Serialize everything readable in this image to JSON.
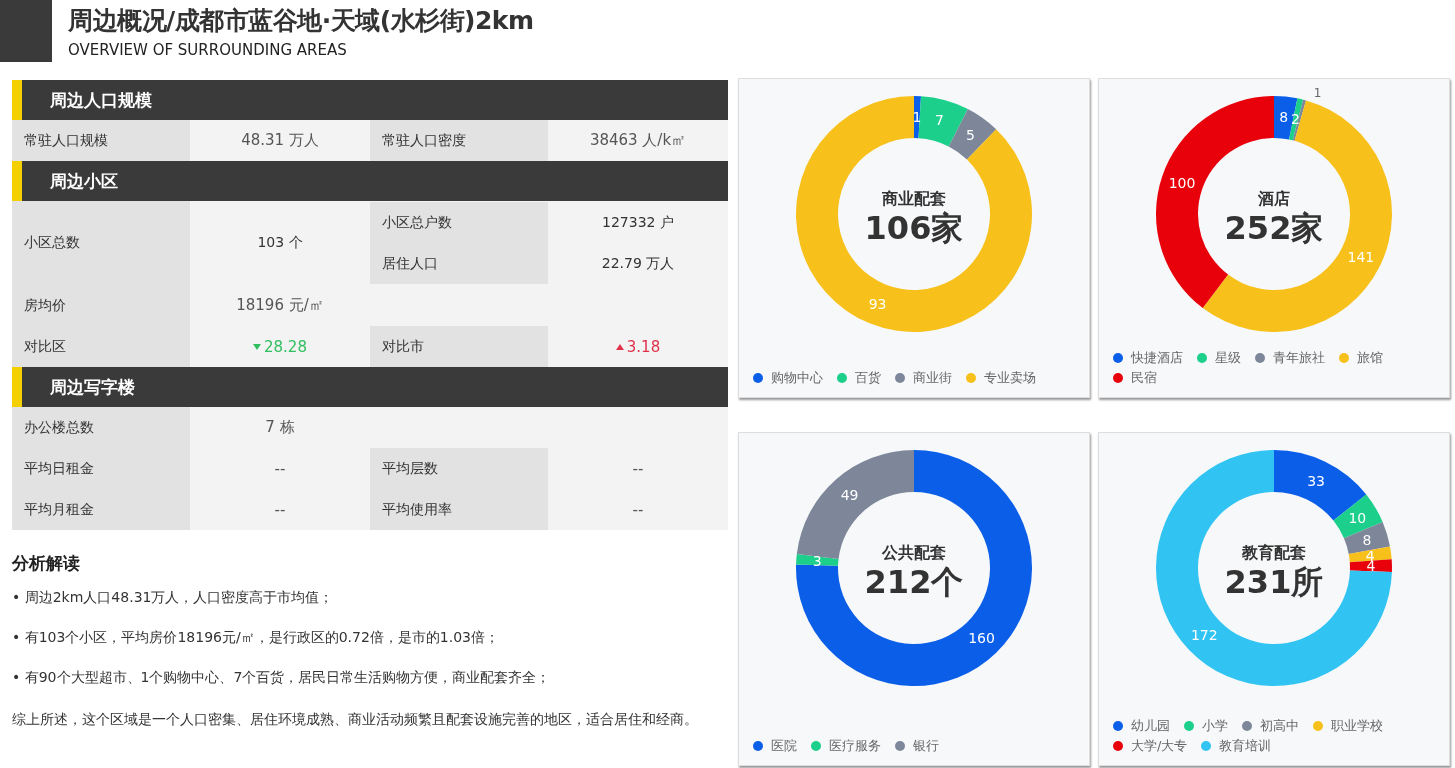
{
  "header": {
    "title": "周边概况/成都市蓝谷地·天域(水杉街)2km",
    "subtitle": "OVERVIEW OF SURROUNDING AREAS"
  },
  "sections": [
    {
      "title": "周边人口规模",
      "rows": [
        {
          "kind": "pair",
          "cells": [
            {
              "label": "常驻人口规模",
              "value": "48.31 万人"
            },
            {
              "label": "常驻人口密度",
              "value": "38463 人/k㎡"
            }
          ]
        }
      ]
    },
    {
      "title": "周边小区",
      "rows": [
        {
          "kind": "stacked",
          "cells": [
            {
              "label": "小区总数",
              "value": "103 个"
            }
          ],
          "side": [
            {
              "label": "小区总户数",
              "value": "127332 户"
            },
            {
              "label": "居住人口",
              "value": "22.79 万人"
            }
          ]
        },
        {
          "kind": "pair",
          "cells": [
            {
              "label": "房均价",
              "value": "18196 元/㎡"
            }
          ]
        },
        {
          "kind": "pair",
          "cells": [
            {
              "label": "对比区",
              "value": "28.28",
              "kind": "decrease"
            },
            {
              "label": "对比市",
              "value": "3.18",
              "kind": "increase"
            }
          ]
        }
      ]
    },
    {
      "title": "周边写字楼",
      "rows": [
        {
          "kind": "pair",
          "cells": [
            {
              "label": "办公楼总数",
              "value": "7 栋"
            }
          ]
        },
        {
          "kind": "pair",
          "cells": [
            {
              "label": "平均日租金",
              "value": "--"
            },
            {
              "label": "平均层数",
              "value": "--"
            }
          ]
        },
        {
          "kind": "pair",
          "cells": [
            {
              "label": "平均月租金",
              "value": "--"
            },
            {
              "label": "平均使用率",
              "value": "--"
            }
          ]
        }
      ]
    }
  ],
  "analysis": {
    "title": "分析解读",
    "bullets": [
      "• 周边2km人口48.31万人，人口密度高于市均值；",
      "• 有103个小区，平均房价18196元/㎡，是行政区的0.72倍，是市的1.03倍；",
      "• 有90个大型超市、1个购物中心、7个百货，居民日常生活购物方便，商业配套齐全；"
    ],
    "summary": "综上所述，这个区域是一个人口密集、居住环境成熟、商业活动频繁且配套设施完善的地区，适合居住和经商。"
  },
  "cards": [
    {
      "center_value": "106家",
      "legend": [
        {
          "label": "购物中心",
          "color": "#0a5ee8"
        },
        {
          "label": "百货",
          "color": "#1ccf8a"
        },
        {
          "label": "商业街",
          "color": "#7d8799"
        },
        {
          "label": "专业卖场",
          "color": "#f7c01a"
        }
      ],
      "chart_data": {
        "type": "donut",
        "title": "商业配套",
        "values": [
          1,
          7,
          5,
          93
        ],
        "data_labels": true
      }
    },
    {
      "center_value": "252家",
      "legend": [
        {
          "label": "快捷酒店",
          "color": "#0a5ee8"
        },
        {
          "label": "星级",
          "color": "#1ccf8a"
        },
        {
          "label": "青年旅社",
          "color": "#7d8799"
        },
        {
          "label": "旅馆",
          "color": "#f7c01a"
        },
        {
          "label": "民宿",
          "color": "#e8000b"
        }
      ],
      "chart_data": {
        "type": "donut",
        "title": "酒店",
        "values": [
          8,
          2,
          1,
          141,
          100
        ],
        "data_labels": true
      }
    },
    {
      "center_value": "212个",
      "legend": [
        {
          "label": "医院",
          "color": "#0a5ee8"
        },
        {
          "label": "医疗服务",
          "color": "#1ccf8a"
        },
        {
          "label": "银行",
          "color": "#7d8799"
        }
      ],
      "chart_data": {
        "type": "donut",
        "title": "公共配套",
        "values": [
          160,
          3,
          49
        ],
        "data_labels": true
      }
    },
    {
      "center_value": "231所",
      "legend": [
        {
          "label": "幼儿园",
          "color": "#0a5ee8"
        },
        {
          "label": "小学",
          "color": "#1ccf8a"
        },
        {
          "label": "初高中",
          "color": "#7d8799"
        },
        {
          "label": "职业学校",
          "color": "#f7c01a"
        },
        {
          "label": "大学/大专",
          "color": "#e8000b"
        },
        {
          "label": "教育培训",
          "color": "#31c4f3"
        }
      ],
      "chart_data": {
        "type": "donut",
        "title": "教育配套",
        "values": [
          33,
          10,
          8,
          4,
          4,
          172
        ],
        "data_labels": true
      }
    }
  ]
}
